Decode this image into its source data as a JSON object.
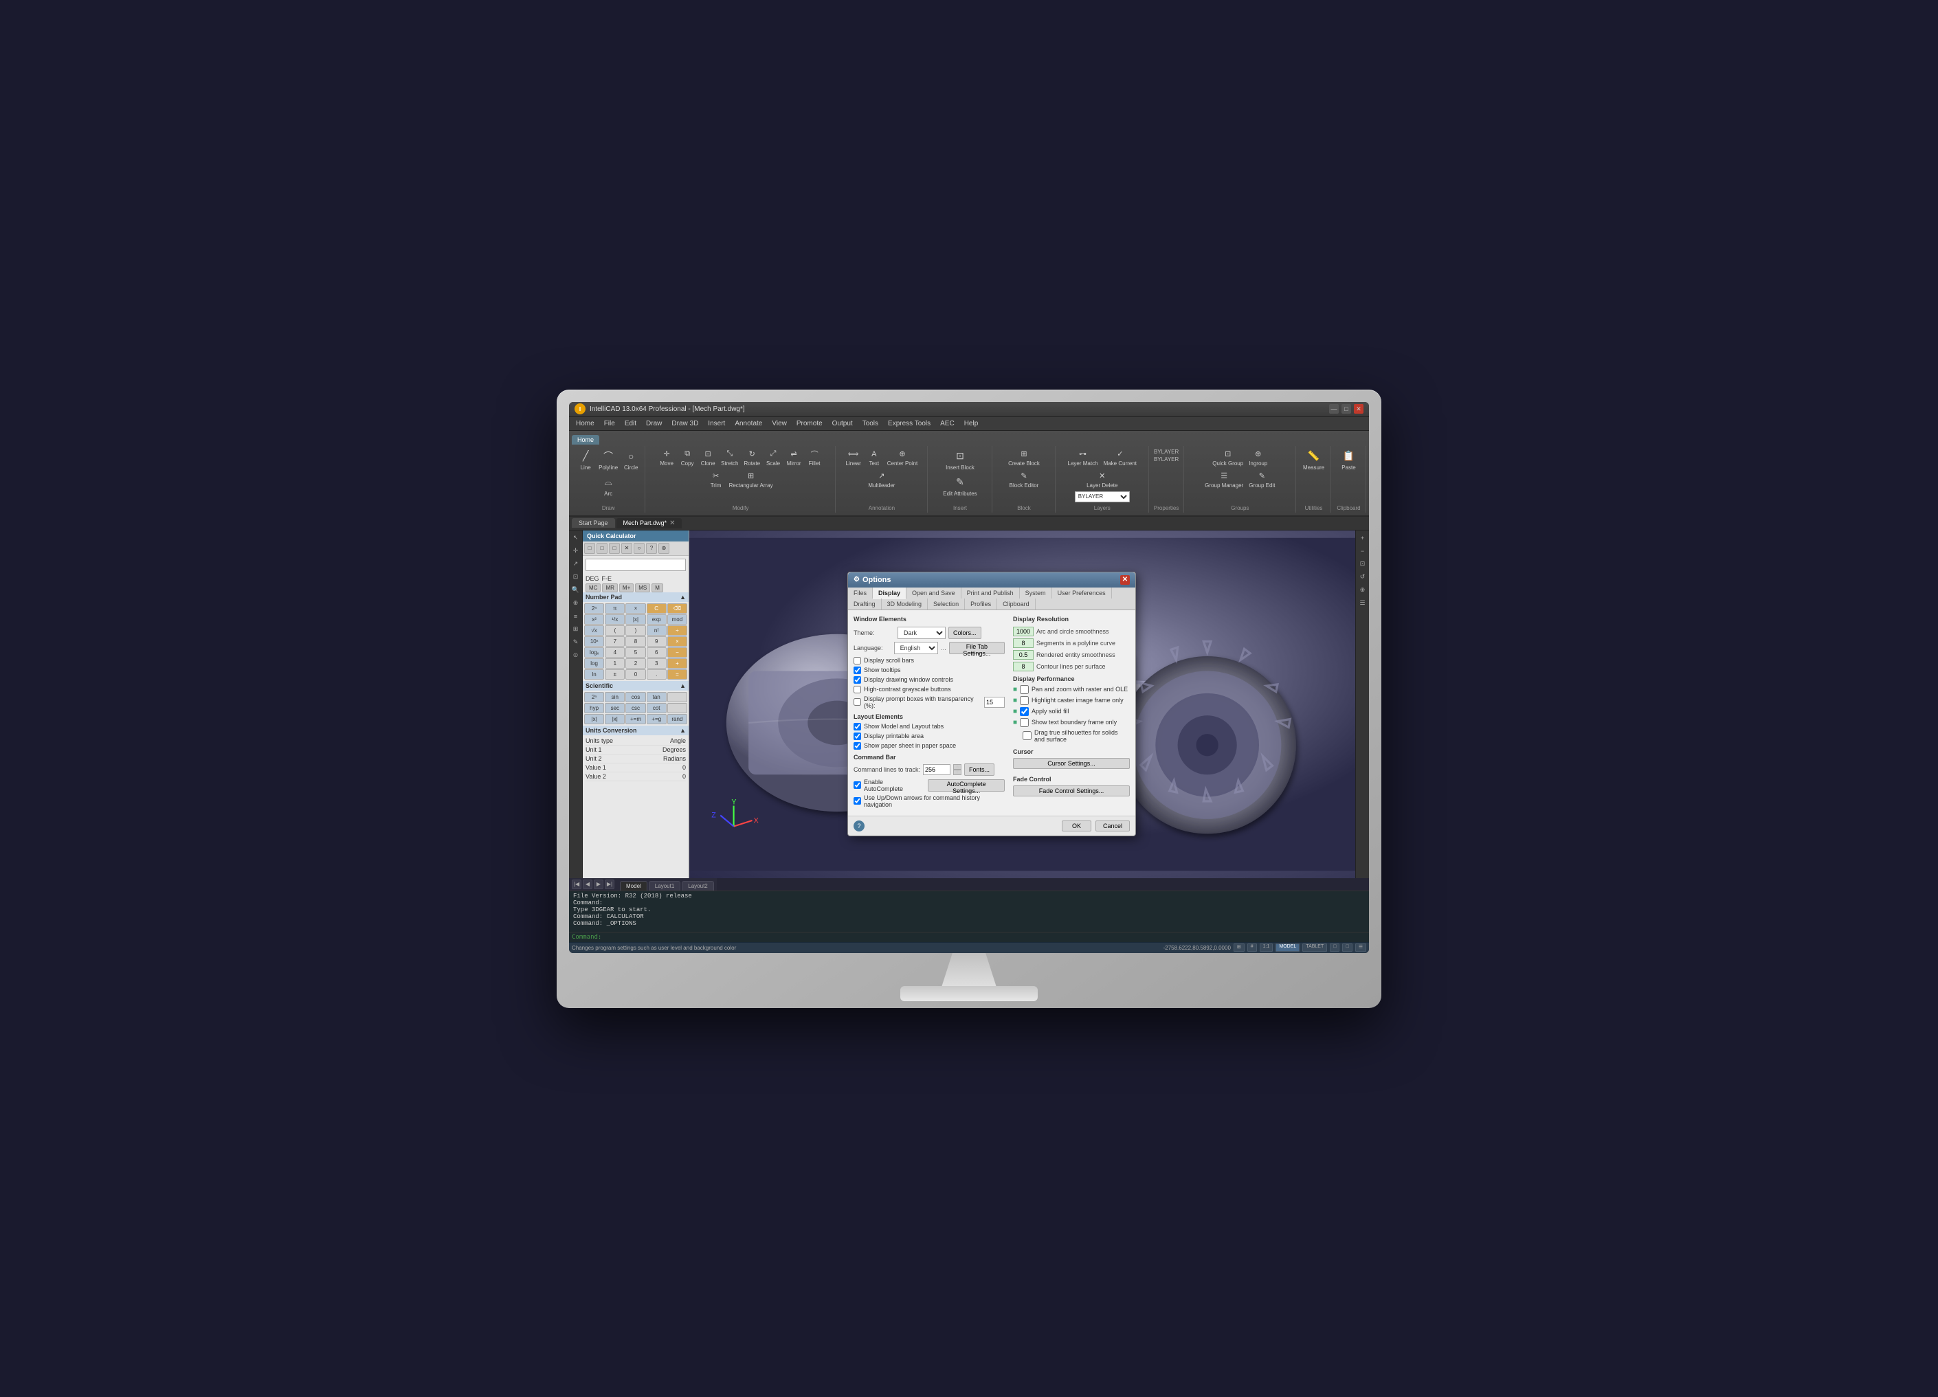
{
  "app": {
    "title": "IntelliCAD 13.0x64 Professional - [Mech Part.dwg*]",
    "logo": "I"
  },
  "titlebar": {
    "minimize": "—",
    "maximize": "□",
    "close": "✕"
  },
  "menu": {
    "items": [
      "Home",
      "File",
      "Edit",
      "Draw",
      "Draw 3D",
      "Insert",
      "Annotate",
      "View",
      "Promote",
      "Output",
      "Tools",
      "Express Tools",
      "AEC",
      "Help"
    ]
  },
  "ribbon": {
    "tabs": [
      "Home"
    ],
    "groups": {
      "draw": {
        "label": "Draw",
        "buttons": [
          "Line",
          "Polyline",
          "Circle",
          "Arc"
        ]
      },
      "modify": {
        "label": "Modify",
        "buttons": [
          "Move",
          "Copy",
          "Clone",
          "Stretch"
        ]
      },
      "annotation": {
        "label": "Annotation",
        "buttons": [
          "Linear",
          "Text",
          "Center Point",
          "Multileader"
        ]
      },
      "block": {
        "label": "Block",
        "buttons": [
          "Create Block",
          "Block Editor",
          "Insert Block"
        ]
      },
      "layers": {
        "label": "Layers",
        "layer_value": "BYLAYER"
      },
      "properties": {
        "label": "Properties"
      },
      "groups": {
        "label": "Groups",
        "buttons": [
          "Quick Group",
          "Ingroup",
          "Group Manager",
          "Group Edit"
        ]
      },
      "utilities": {
        "label": "Utilities",
        "buttons": [
          "Measure"
        ]
      },
      "clipboard": {
        "label": "Clipboard",
        "buttons": [
          "Paste"
        ]
      }
    }
  },
  "tabs": {
    "start": "Start Page",
    "drawing": "Mech Part.dwg*",
    "close": "✕"
  },
  "calculator": {
    "title": "Quick Calculator",
    "display_value": "",
    "mode": {
      "deg_label": "DEG",
      "format_label": "F-E"
    },
    "toolbar_buttons": [
      "□",
      "□",
      "□",
      "✕",
      "○",
      "?",
      "⊕"
    ],
    "keypad": {
      "section": "Number Pad",
      "keys": [
        [
          "2ⁿ",
          "π",
          "×",
          "C",
          "⌫"
        ],
        [
          "x²",
          "¹/x",
          "|x|",
          "exp",
          "mod"
        ],
        [
          "√x",
          "(",
          ")",
          "n!",
          "÷"
        ],
        [
          "10ˣ",
          "7",
          "8",
          "9",
          "×"
        ],
        [
          "logₓ",
          "4",
          "5",
          "6",
          "−"
        ],
        [
          "log",
          "1",
          "2",
          "3",
          "+"
        ],
        [
          "ln",
          "±",
          "0",
          ".",
          "="
        ]
      ]
    },
    "scientific": {
      "section": "Scientific",
      "keys": [
        [
          "2ⁿ",
          "sin",
          "cos",
          "tan"
        ],
        [
          "hyp",
          "sec",
          "csc",
          "cot"
        ],
        [
          "|x|",
          "|x|",
          "+=m",
          "+=g",
          "rand"
        ]
      ]
    },
    "units": {
      "section": "Units Conversion",
      "rows": [
        [
          "Units type",
          "Angle"
        ],
        [
          "Unit 1",
          "Degrees"
        ],
        [
          "Unit 2",
          "Radians"
        ],
        [
          "Value 1",
          "0"
        ],
        [
          "Value 2",
          "0"
        ]
      ]
    }
  },
  "dialog": {
    "title": "Options",
    "tabs": [
      "Files",
      "Display",
      "Open and Save",
      "Print and Publish",
      "System",
      "User Preferences",
      "Drafting",
      "3D Modeling",
      "Selection",
      "Profiles",
      "Clipboard"
    ],
    "active_tab": "Display",
    "sections": {
      "window_elements": {
        "title": "Window Elements",
        "theme_label": "Theme:",
        "theme_value": "Dark",
        "language_label": "Language:",
        "language_value": "English",
        "colors_btn": "Colors...",
        "file_tab_btn": "File Tab Settings...",
        "checkboxes": [
          {
            "label": "Display scroll bars",
            "checked": false
          },
          {
            "label": "Show tooltips",
            "checked": true
          },
          {
            "label": "Display drawing window controls",
            "checked": true
          },
          {
            "label": "High-contrast grayscale buttons",
            "checked": false
          },
          {
            "label": "Display prompt boxes with transparency (%):",
            "checked": false
          }
        ],
        "transparency_value": "15"
      },
      "layout_elements": {
        "title": "Layout Elements",
        "checkboxes": [
          {
            "label": "Show Model and Layout tabs",
            "checked": true
          },
          {
            "label": "Display printable area",
            "checked": true
          },
          {
            "label": "Show paper sheet in paper space",
            "checked": true
          }
        ]
      },
      "command_bar": {
        "title": "Command Bar",
        "cmd_lines_label": "Command lines to track:",
        "cmd_lines_value": "256",
        "fonts_btn": "Fonts...",
        "checkboxes": [
          {
            "label": "Enable AutoComplete",
            "checked": true
          },
          {
            "label": "Use Up/Down arrows for command history navigation",
            "checked": true
          }
        ],
        "autocomplete_btn": "AutoComplete Settings..."
      },
      "display_resolution": {
        "title": "Display Resolution",
        "rows": [
          {
            "value": "1000",
            "label": "Arc and circle smoothness"
          },
          {
            "value": "8",
            "label": "Segments in a polyline curve"
          },
          {
            "value": "0.5",
            "label": "Rendered entity smoothness"
          },
          {
            "value": "8",
            "label": "Contour lines per surface"
          }
        ]
      },
      "display_performance": {
        "title": "Display Performance",
        "checkboxes": [
          {
            "label": "Pan and zoom with raster and OLE",
            "checked": false,
            "icon": true
          },
          {
            "label": "Highlight caster image frame only",
            "checked": false,
            "icon": true
          },
          {
            "label": "Apply solid fill",
            "checked": true,
            "icon": true
          },
          {
            "label": "Show text boundary frame only",
            "checked": false,
            "icon": true
          },
          {
            "label": "Drag true silhouettes for solids and surface",
            "checked": false
          }
        ]
      },
      "cursor": {
        "title": "Cursor",
        "settings_btn": "Cursor Settings..."
      },
      "fade_control": {
        "title": "Fade Control",
        "settings_btn": "Fade Control Settings..."
      }
    },
    "footer": {
      "ok_btn": "OK",
      "cancel_btn": "Cancel",
      "help_icon": "?"
    }
  },
  "viewport": {
    "label": "",
    "axis": {
      "x": "X",
      "y": "Y",
      "z": "Z"
    }
  },
  "layout_tabs": {
    "model": "Model",
    "layout1": "Layout1",
    "layout2": "Layout2"
  },
  "command_output": [
    "File Version: R32 (2018) release",
    "Command:",
    "Type 3DGEAR to start.",
    "Command: CALCULATOR",
    "Command: _OPTIONS"
  ],
  "status_bar": {
    "coords": "-2758.6222,80.5892,0.0000",
    "snap_label": "1:1",
    "mode_label": "MODEL",
    "tablet_label": "TABLET",
    "status_info": "Changes program settings such as user level and background color"
  }
}
